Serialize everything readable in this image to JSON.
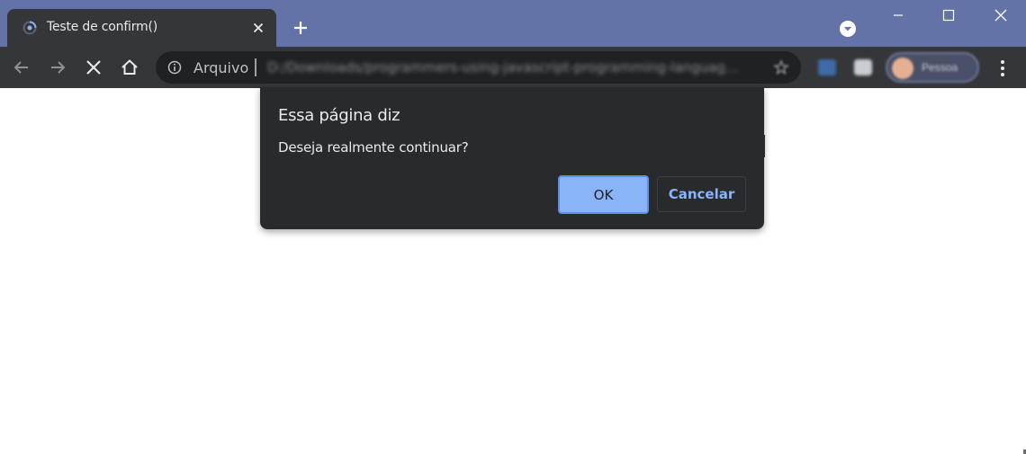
{
  "tab": {
    "title": "Teste de confirm()"
  },
  "toolbar": {
    "site_label": "Arquivo",
    "url": "D:/Downloads/programmers-using-javascript-programming-languag...",
    "profile_label": "Pessoa"
  },
  "dialog": {
    "title": "Essa página diz",
    "message": "Deseja realmente continuar?",
    "ok_label": "OK",
    "cancel_label": "Cancelar"
  },
  "colors": {
    "titlebar": "#6373a8",
    "toolbar": "#35363a",
    "dialog_bg": "#292a2d",
    "accent": "#8ab4f8"
  }
}
